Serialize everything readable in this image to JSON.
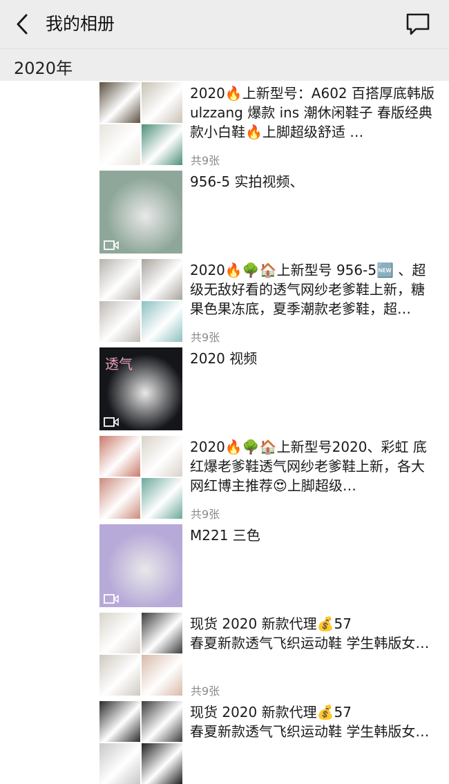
{
  "header": {
    "back_icon": "chevron-left-icon",
    "title": "我的相册",
    "comment_icon": "comment-icon"
  },
  "year": "2020年",
  "posts": [
    {
      "caption": "2020🔥上新型号：A602 百搭厚底韩版 ulzzang 爆款 ins 潮休闲鞋子 春版经典款小白鞋🔥上脚超级舒适 …",
      "count": "共9张",
      "media": "grid",
      "video": false,
      "colors": [
        "#5b5040",
        "#c9c2b6",
        "#e8e4dc",
        "#4d8f7a"
      ]
    },
    {
      "caption": "956-5 实拍视频、",
      "count": "",
      "media": "single",
      "video": true,
      "colors": [
        "#8fa79a"
      ]
    },
    {
      "caption": "2020🔥🌳🏠上新型号 956-5🆕 、超级无敌好看的透气网纱老爹鞋上新，糖果色果冻底，夏季潮款老爹鞋，超…",
      "count": "共9张",
      "media": "grid",
      "video": false,
      "colors": [
        "#b7b2ad",
        "#a8a39d",
        "#bfb9b4",
        "#8dbfc0"
      ]
    },
    {
      "caption": "2020 视频",
      "count": "",
      "media": "single",
      "video": true,
      "overlay": "透气",
      "colors": [
        "#15161a"
      ]
    },
    {
      "caption": "2020🔥🌳🏠上新型号2020、彩虹 底红爆老爹鞋透气网纱老爹鞋上新，各大网红博主推荐😍上脚超级…",
      "count": "共9张",
      "media": "grid",
      "video": false,
      "colors": [
        "#c97a6a",
        "#d8d2c8",
        "#cc8a7b",
        "#6aa89a"
      ]
    },
    {
      "caption": "M221 三色",
      "count": "",
      "media": "single",
      "video": true,
      "colors": [
        "#b7a9d8"
      ]
    },
    {
      "caption": "现货 2020 新款代理💰57\n春夏新款透气飞织运动鞋 学生韩版女…",
      "count": "共9张",
      "media": "grid",
      "video": false,
      "colors": [
        "#d9d3cb",
        "#3a3a3a",
        "#cfc8c0",
        "#d8b9a8"
      ]
    },
    {
      "caption": "现货 2020 新款代理💰57\n春夏新款透气飞织运动鞋 学生韩版女…",
      "count": "",
      "media": "grid",
      "video": false,
      "colors": [
        "#2a2a2a",
        "#3c3c3c",
        "#c8c8c8",
        "#1f1f1f"
      ]
    }
  ]
}
